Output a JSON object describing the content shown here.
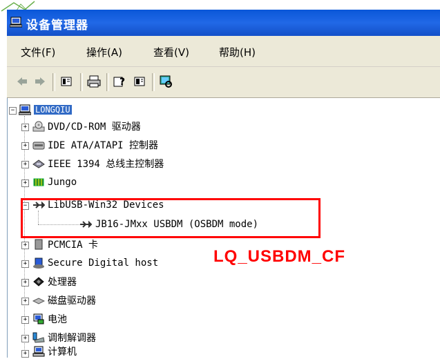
{
  "window": {
    "title": "设备管理器",
    "icon": "computer-icon"
  },
  "menu": [
    {
      "label": "文件(F)"
    },
    {
      "label": "操作(A)"
    },
    {
      "label": "查看(V)"
    },
    {
      "label": "帮助(H)"
    }
  ],
  "toolbar": {
    "buttons": [
      "back-arrow-icon",
      "forward-arrow-icon",
      "properties-icon",
      "print-icon",
      "help-icon",
      "view-icon",
      "scan-hardware-icon"
    ]
  },
  "tree": {
    "root": {
      "label": "LONGQIU",
      "selected": true
    },
    "items": [
      {
        "label": "DVD/CD-ROM 驱动器",
        "icon": "cdrom-icon",
        "expanded": false
      },
      {
        "label": "IDE ATA/ATAPI 控制器",
        "icon": "ide-controller-icon",
        "expanded": false
      },
      {
        "label": "IEEE 1394 总线主控制器",
        "icon": "ieee1394-icon",
        "expanded": false
      },
      {
        "label": "Jungo",
        "icon": "jungo-icon",
        "expanded": false
      },
      {
        "label": "LibUSB-Win32 Devices",
        "icon": "usb-icon",
        "expanded": true,
        "children": [
          {
            "label": "JB16-JMxx USBDM (OSBDM mode)",
            "icon": "usb-icon"
          }
        ]
      },
      {
        "label": "PCMCIA 卡",
        "icon": "pcmcia-icon",
        "expanded": false
      },
      {
        "label": "Secure Digital host",
        "icon": "sd-host-icon",
        "expanded": false
      },
      {
        "label": "处理器",
        "icon": "processor-icon",
        "expanded": false
      },
      {
        "label": "磁盘驱动器",
        "icon": "disk-drive-icon",
        "expanded": false
      },
      {
        "label": "电池",
        "icon": "battery-icon",
        "expanded": false
      },
      {
        "label": "调制解调器",
        "icon": "modem-icon",
        "expanded": false
      },
      {
        "label": "计算机",
        "icon": "computer-icon",
        "expanded": false
      }
    ]
  },
  "annotation": {
    "text": "LQ_USBDM_CF",
    "color": "#ff0000"
  },
  "colors": {
    "titlebar": "#0a57d8",
    "selection": "#316ac5",
    "highlight_box": "#ff0000"
  }
}
